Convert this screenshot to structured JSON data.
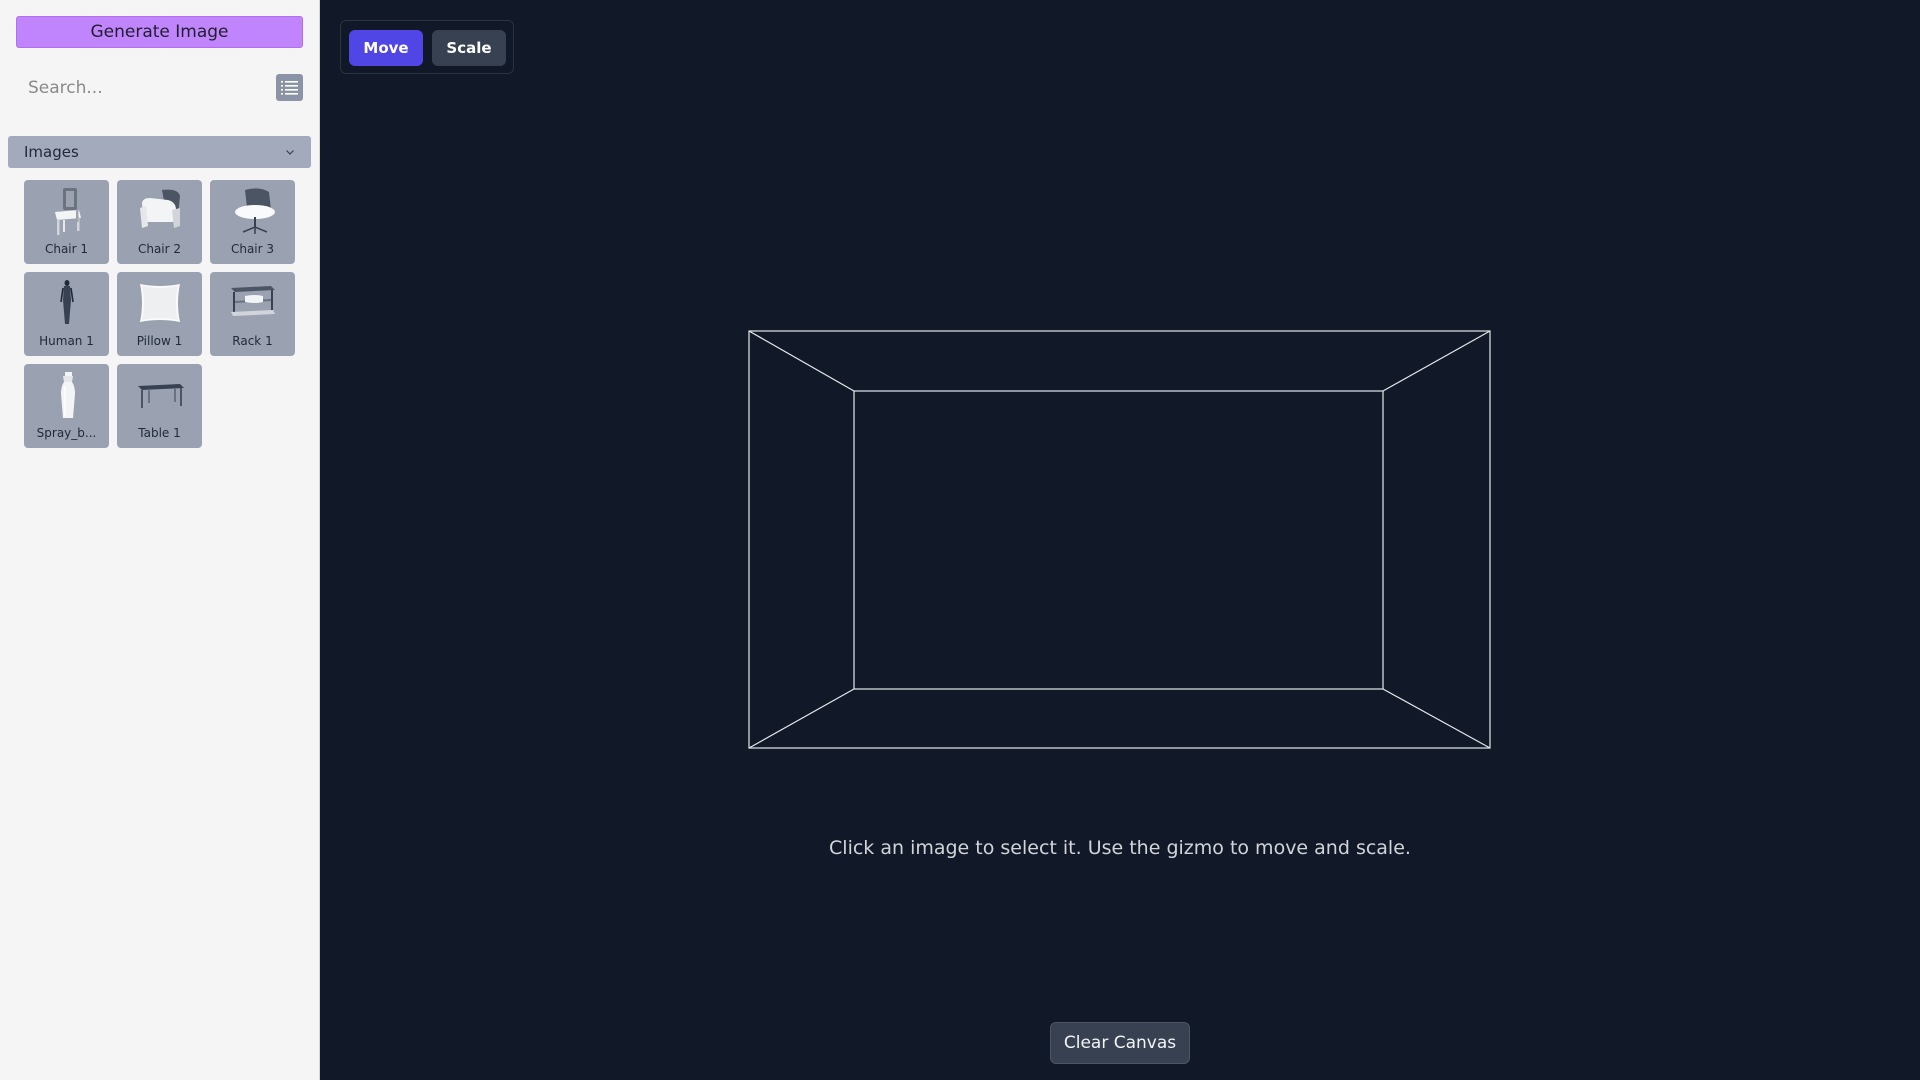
{
  "sidebar": {
    "generate_label": "Generate Image",
    "search_placeholder": "Search...",
    "list_icon": "list-icon",
    "section_title": "Images",
    "items": [
      {
        "label": "Chair 1",
        "icon": "chair-icon"
      },
      {
        "label": "Chair 2",
        "icon": "armchair-icon"
      },
      {
        "label": "Chair 3",
        "icon": "swivel-chair-icon"
      },
      {
        "label": "Human 1",
        "icon": "human-figure-icon"
      },
      {
        "label": "Pillow 1",
        "icon": "pillow-icon"
      },
      {
        "label": "Rack 1",
        "icon": "rack-icon"
      },
      {
        "label": "Spray_b...",
        "icon": "spray-bottle-icon"
      },
      {
        "label": "Table 1",
        "icon": "table-icon"
      }
    ]
  },
  "toolbar": {
    "move_label": "Move",
    "scale_label": "Scale",
    "active": "Move"
  },
  "canvas": {
    "hint": "Click an image to select it. Use the gizmo to move and scale.",
    "clear_label": "Clear Canvas"
  },
  "colors": {
    "accent": "#4f46e5",
    "generate_button": "#c084fc",
    "canvas_background": "#111827",
    "sidebar_background": "#f5f5f5"
  }
}
